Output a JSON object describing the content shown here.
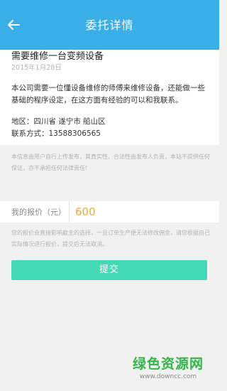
{
  "header": {
    "title": "委托详情",
    "back_icon": "arrow-left-icon",
    "bg_color": "#3aaee6"
  },
  "task": {
    "title": "需要维修一台变频设备",
    "date": "2015年1月28日",
    "description": "本公司需要一位懂设备维修的师傅来维修设备，还能做一些基础的程序设定，在这方面有经验的可以和我联系。",
    "address": "地区：四川省  遂宁市  船山区",
    "contact": "联系方式：13588306565"
  },
  "disclaimer": "本信息由用户自行上传发布，其真实性、合法性由发布人负责，本站不提供任何保证，亦不承担任何法律责任!",
  "quote": {
    "label": "我的报价（元）",
    "value": "600",
    "note": "您的报价会直接影响雇主的选择，一旦订单生产便无法修改佣金，请您根据自己实际情况进行报价，提交后无法取消。"
  },
  "submit": {
    "label": "提交",
    "color": "#44dab7"
  },
  "watermark": {
    "main": "绿色资源网",
    "url": "www.downcc.com"
  }
}
